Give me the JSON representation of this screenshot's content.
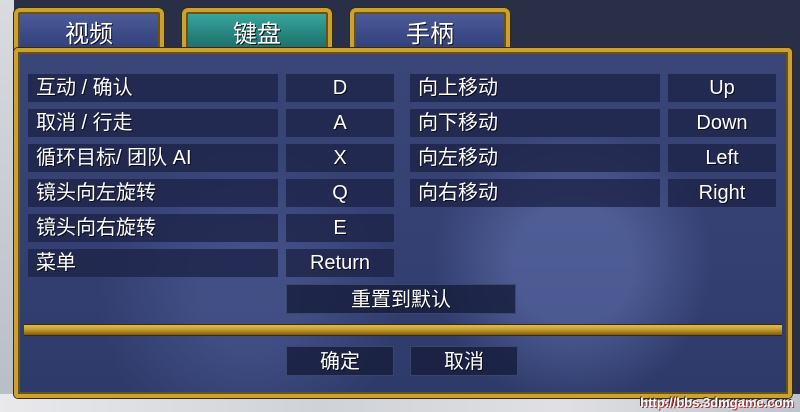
{
  "tabs": [
    {
      "label": "视频",
      "active": false
    },
    {
      "label": "键盘",
      "active": true
    },
    {
      "label": "手柄",
      "active": false
    }
  ],
  "bindings_left": [
    {
      "action": "互动 / 确认",
      "key": "D"
    },
    {
      "action": "取消 / 行走",
      "key": "A"
    },
    {
      "action": "循环目标/ 团队 AI",
      "key": "X"
    },
    {
      "action": "镜头向左旋转",
      "key": "Q"
    },
    {
      "action": "镜头向右旋转",
      "key": "E"
    },
    {
      "action": "菜单",
      "key": "Return"
    }
  ],
  "bindings_right": [
    {
      "action": "向上移动",
      "key": "Up"
    },
    {
      "action": "向下移动",
      "key": "Down"
    },
    {
      "action": "向左移动",
      "key": "Left"
    },
    {
      "action": "向右移动",
      "key": "Right"
    }
  ],
  "reset_label": "重置到默认",
  "confirm_label": "确定",
  "cancel_label": "取消",
  "watermark": "http://bbs.3dmgame.com",
  "colors": {
    "gold_frame": "#c9a233",
    "tab_active": "#27867f",
    "tab_inactive": "#3b4a86",
    "panel_bg": "#354173"
  }
}
